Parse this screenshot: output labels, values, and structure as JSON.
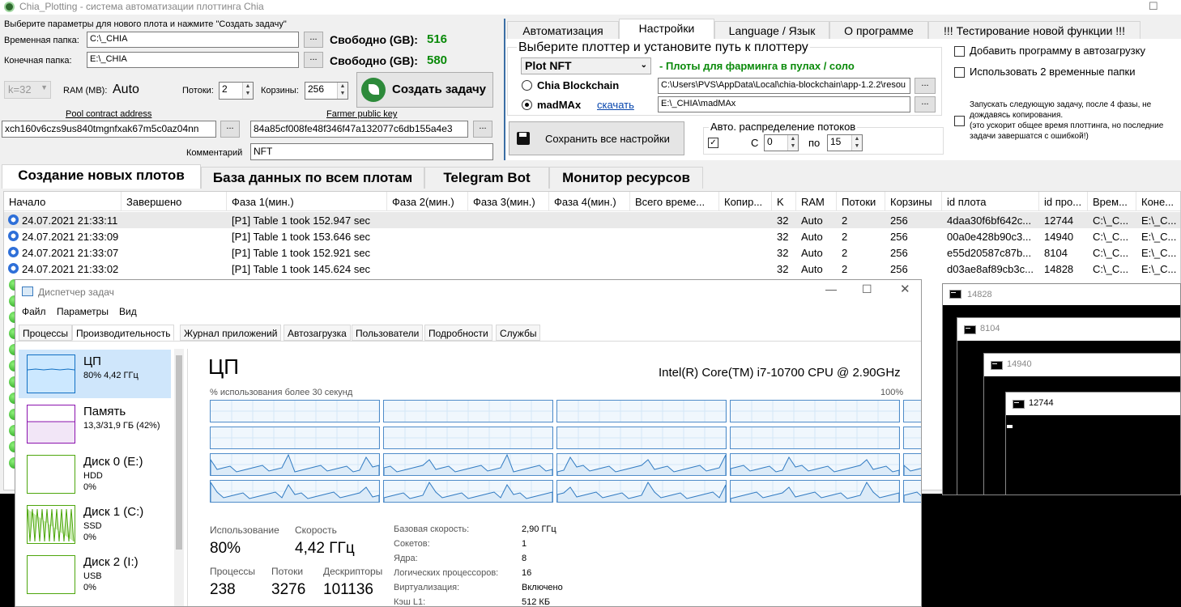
{
  "app": {
    "title": "Chia_Plotting - система автоматизации плоттинга Chia",
    "instruction": "Выберите параметры для нового плота и нажмите \"Создать задачу\"",
    "temp_label": "Временная папка:",
    "temp_value": "C:\\_CHIA",
    "final_label": "Конечная папка:",
    "final_value": "E:\\_CHIA",
    "browse": "...",
    "free_label": "Свободно (GB):",
    "free_temp": "516",
    "free_final": "580",
    "k_value": "k=32",
    "ram_label": "RAM (MB):",
    "ram_value": "Auto",
    "threads_label": "Потоки:",
    "threads_value": "2",
    "buckets_label": "Корзины:",
    "buckets_value": "256",
    "create_button": "Создать задачу",
    "pool_label": "Pool contract address",
    "pool_value": "xch160v6czs9us840tmgnfxak67m5c0az04nn",
    "farmer_label": "Farmer public key",
    "farmer_value": "84a85cf008fe48f346f47a132077c6db155a4e3",
    "comment_label": "Комментарий",
    "comment_value": "NFT"
  },
  "settings": {
    "tabs": [
      "Автоматизация",
      "Настройки",
      "Language / Язык",
      "О программе",
      "!!! Тестирование новой функции !!!"
    ],
    "group_title": "Выберите плоттер и установите путь к плоттеру",
    "plot_type": "Plot NFT",
    "plot_hint": "- Плоты для фарминга в пулах / соло",
    "chia_label": "Chia Blockchain",
    "chia_path": "C:\\Users\\PVS\\AppData\\Local\\chia-blockchain\\app-1.2.2\\resou",
    "madmax_label": "madMAx",
    "download_link": "скачать",
    "madmax_path": "E:\\_CHIA\\madMAx",
    "save_button": "Сохранить все настройки",
    "dist_title": "Авто. распределение потоков",
    "from_label": "С",
    "from_value": "0",
    "to_label": "по",
    "to_value": "15",
    "autostart": "Добавить программу в автозагрузку",
    "two_temp": "Использовать 2 временные папки",
    "next_task": "Запускать следующую задачу, после 4 фазы, не дождавясь копирования.",
    "next_task_note": "(это ускорит общее время плоттинга, но последние задачи завершатся с ошибкой!)"
  },
  "main_tabs": [
    "Создание новых плотов",
    "База данных по всем плотам",
    "Telegram Bot",
    "Монитор ресурсов"
  ],
  "grid": {
    "columns": [
      "Начало",
      "Завершено",
      "Фаза 1(мин.)",
      "Фаза 2(мин.)",
      "Фаза 3(мин.)",
      "Фаза 4(мин.)",
      "Всего време...",
      "Копир...",
      "K",
      "RAM",
      "Потоки",
      "Корзины",
      "id плота",
      "id про...",
      "Врем...",
      "Коне..."
    ],
    "rows": [
      [
        "24.07.2021 21:33:11",
        "",
        "[P1] Table 1 took 152.947 sec",
        "",
        "",
        "",
        "",
        "",
        "32",
        "Auto",
        "2",
        "256",
        "4daa30f6bf642c...",
        "12744",
        "C:\\_C...",
        "E:\\_C..."
      ],
      [
        "24.07.2021 21:33:09",
        "",
        "[P1] Table 1 took 153.646 sec",
        "",
        "",
        "",
        "",
        "",
        "32",
        "Auto",
        "2",
        "256",
        "00a0e428b90c3...",
        "14940",
        "C:\\_C...",
        "E:\\_C..."
      ],
      [
        "24.07.2021 21:33:07",
        "",
        "[P1] Table 1 took 152.921 sec",
        "",
        "",
        "",
        "",
        "",
        "32",
        "Auto",
        "2",
        "256",
        "e55d20587c87b...",
        "8104",
        "C:\\_C...",
        "E:\\_C..."
      ],
      [
        "24.07.2021 21:33:02",
        "",
        "[P1] Table 1 took 145.624 sec",
        "",
        "",
        "",
        "",
        "",
        "32",
        "Auto",
        "2",
        "256",
        "d03ae8af89cb3c...",
        "14828",
        "C:\\_C...",
        "E:\\_C..."
      ]
    ]
  },
  "taskmgr": {
    "title": "Диспетчер задач",
    "menu": [
      "Файл",
      "Параметры",
      "Вид"
    ],
    "tabs": [
      "Процессы",
      "Производительность",
      "Журнал приложений",
      "Автозагрузка",
      "Пользователи",
      "Подробности",
      "Службы"
    ],
    "side": [
      {
        "name": "ЦП",
        "sub1": "80% 4,42 ГГц",
        "sub2": ""
      },
      {
        "name": "Память",
        "sub1": "13,3/31,9 ГБ (42%)",
        "sub2": ""
      },
      {
        "name": "Диск 0 (E:)",
        "sub1": "HDD",
        "sub2": "0%"
      },
      {
        "name": "Диск 1 (C:)",
        "sub1": "SSD",
        "sub2": "0%"
      },
      {
        "name": "Диск 2 (I:)",
        "sub1": "USB",
        "sub2": "0%"
      }
    ],
    "cpu_heading": "ЦП",
    "cpu_model": "Intel(R) Core(TM) i7-10700 CPU @ 2.90GHz",
    "graph_label": "% использования более 30 секунд",
    "graph_max": "100%",
    "usage_label": "Использование",
    "usage_value": "80%",
    "speed_label": "Скорость",
    "speed_value": "4,42 ГГц",
    "proc_label": "Процессы",
    "proc_value": "238",
    "threads_label": "Потоки",
    "threads_value": "3276",
    "handles_label": "Дескрипторы",
    "handles_value": "101136",
    "kv": [
      [
        "Базовая скорость:",
        "2,90 ГГц"
      ],
      [
        "Сокетов:",
        "1"
      ],
      [
        "Ядра:",
        "8"
      ],
      [
        "Логических процессоров:",
        "16"
      ],
      [
        "Виртуализация:",
        "Включено"
      ],
      [
        "Кэш L1:",
        "512 КБ"
      ]
    ]
  },
  "consoles": [
    "14828",
    "8104",
    "14940",
    "12744"
  ]
}
